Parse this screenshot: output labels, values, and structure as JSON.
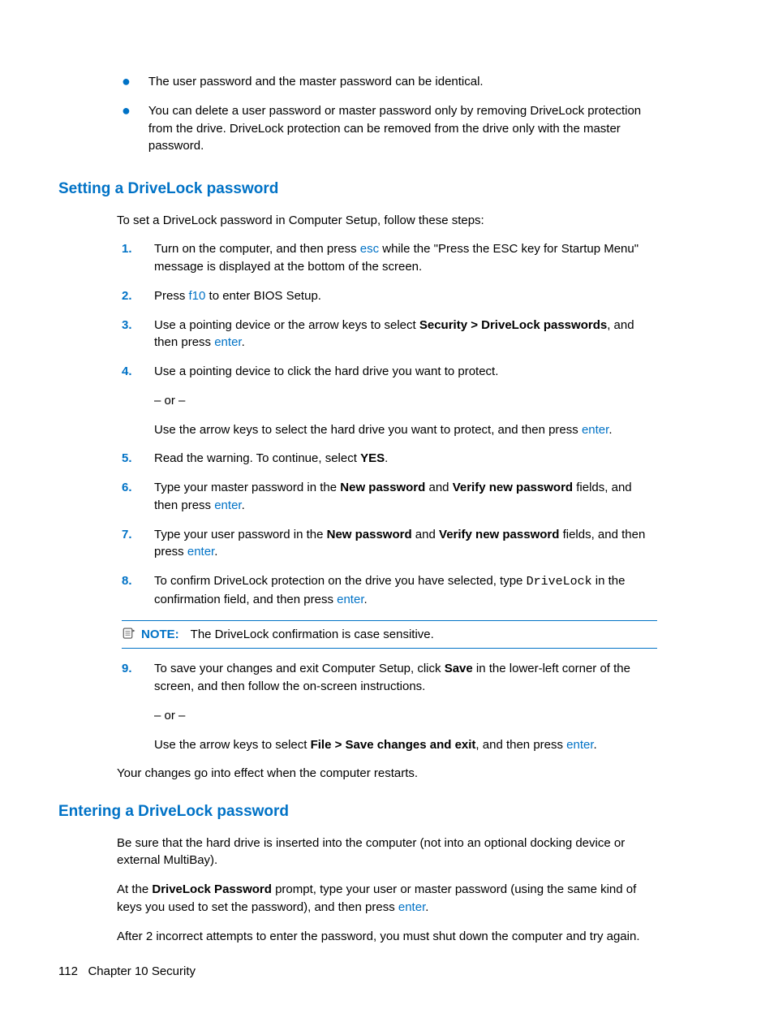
{
  "bullets": {
    "b1": "The user password and the master password can be identical.",
    "b2": "You can delete a user password or master password only by removing DriveLock protection from the drive. DriveLock protection can be removed from the drive only with the master password."
  },
  "section1": {
    "title": "Setting a DriveLock password",
    "intro": "To set a DriveLock password in Computer Setup, follow these steps:",
    "steps": {
      "n1": "1.",
      "s1a": "Turn on the computer, and then press ",
      "s1_key": "esc",
      "s1b": " while the \"Press the ESC key for Startup Menu\" message is displayed at the bottom of the screen.",
      "n2": "2.",
      "s2a": "Press ",
      "s2_key": "f10",
      "s2b": " to enter BIOS Setup.",
      "n3": "3.",
      "s3a": "Use a pointing device or the arrow keys to select ",
      "s3_bold": "Security > DriveLock passwords",
      "s3b": ", and then press ",
      "s3_key": "enter",
      "s3c": ".",
      "n4": "4.",
      "s4a": "Use a pointing device to click the hard drive you want to protect.",
      "s4_or": "– or –",
      "s4b": "Use the arrow keys to select the hard drive you want to protect, and then press ",
      "s4_key": "enter",
      "s4c": ".",
      "n5": "5.",
      "s5a": "Read the warning. To continue, select ",
      "s5_bold": "YES",
      "s5b": ".",
      "n6": "6.",
      "s6a": "Type your master password in the ",
      "s6_bold1": "New password",
      "s6b": " and ",
      "s6_bold2": "Verify new password",
      "s6c": " fields, and then press ",
      "s6_key": "enter",
      "s6d": ".",
      "n7": "7.",
      "s7a": "Type your user password in the ",
      "s7_bold1": "New password",
      "s7b": " and ",
      "s7_bold2": "Verify new password",
      "s7c": " fields, and then press ",
      "s7_key": "enter",
      "s7d": ".",
      "n8": "8.",
      "s8a": "To confirm DriveLock protection on the drive you have selected, type ",
      "s8_mono": "DriveLock",
      "s8b": " in the confirmation field, and then press ",
      "s8_key": "enter",
      "s8c": ".",
      "note_label": "NOTE:",
      "note_text": "The DriveLock confirmation is case sensitive.",
      "n9": "9.",
      "s9a": "To save your changes and exit Computer Setup, click ",
      "s9_bold1": "Save",
      "s9b": " in the lower-left corner of the screen, and then follow the on-screen instructions.",
      "s9_or": "– or –",
      "s9c": "Use the arrow keys to select ",
      "s9_bold2": "File > Save changes and exit",
      "s9d": ", and then press ",
      "s9_key": "enter",
      "s9e": "."
    },
    "closing": "Your changes go into effect when the computer restarts."
  },
  "section2": {
    "title": "Entering a DriveLock password",
    "p1": "Be sure that the hard drive is inserted into the computer (not into an optional docking device or external MultiBay).",
    "p2a": "At the ",
    "p2_bold": "DriveLock Password",
    "p2b": " prompt, type your user or master password (using the same kind of keys you used to set the password), and then press ",
    "p2_key": "enter",
    "p2c": ".",
    "p3": "After 2 incorrect attempts to enter the password, you must shut down the computer and try again."
  },
  "footer": {
    "page": "112",
    "chapter": "Chapter 10   Security"
  }
}
